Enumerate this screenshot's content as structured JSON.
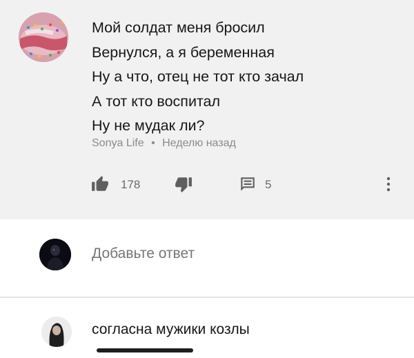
{
  "comment": {
    "avatar_icon": "donut-avatar",
    "lines": [
      "Мой солдат меня бросил",
      "Вернулся, а я беременная",
      "Ну а что, отец не тот кто зачал",
      "А тот кто воспитал",
      "Ну не мудак ли?"
    ],
    "author": "Sonya Life",
    "separator": "•",
    "time": "Неделю назад",
    "likes": "178",
    "replies": "5",
    "icons": {
      "like": "thumbs-up-icon",
      "dislike": "thumbs-down-icon",
      "reply": "reply-icon",
      "more": "more-vert-icon"
    }
  },
  "add_reply": {
    "avatar_icon": "user-avatar",
    "placeholder": "Добавьте ответ"
  },
  "reply": {
    "avatar_icon": "reply-author-avatar",
    "text": "согласна мужики козлы"
  },
  "colors": {
    "comment_bg": "#f1f1f1",
    "text": "#161616",
    "meta": "#8a8a8a",
    "icon": "#606060"
  }
}
